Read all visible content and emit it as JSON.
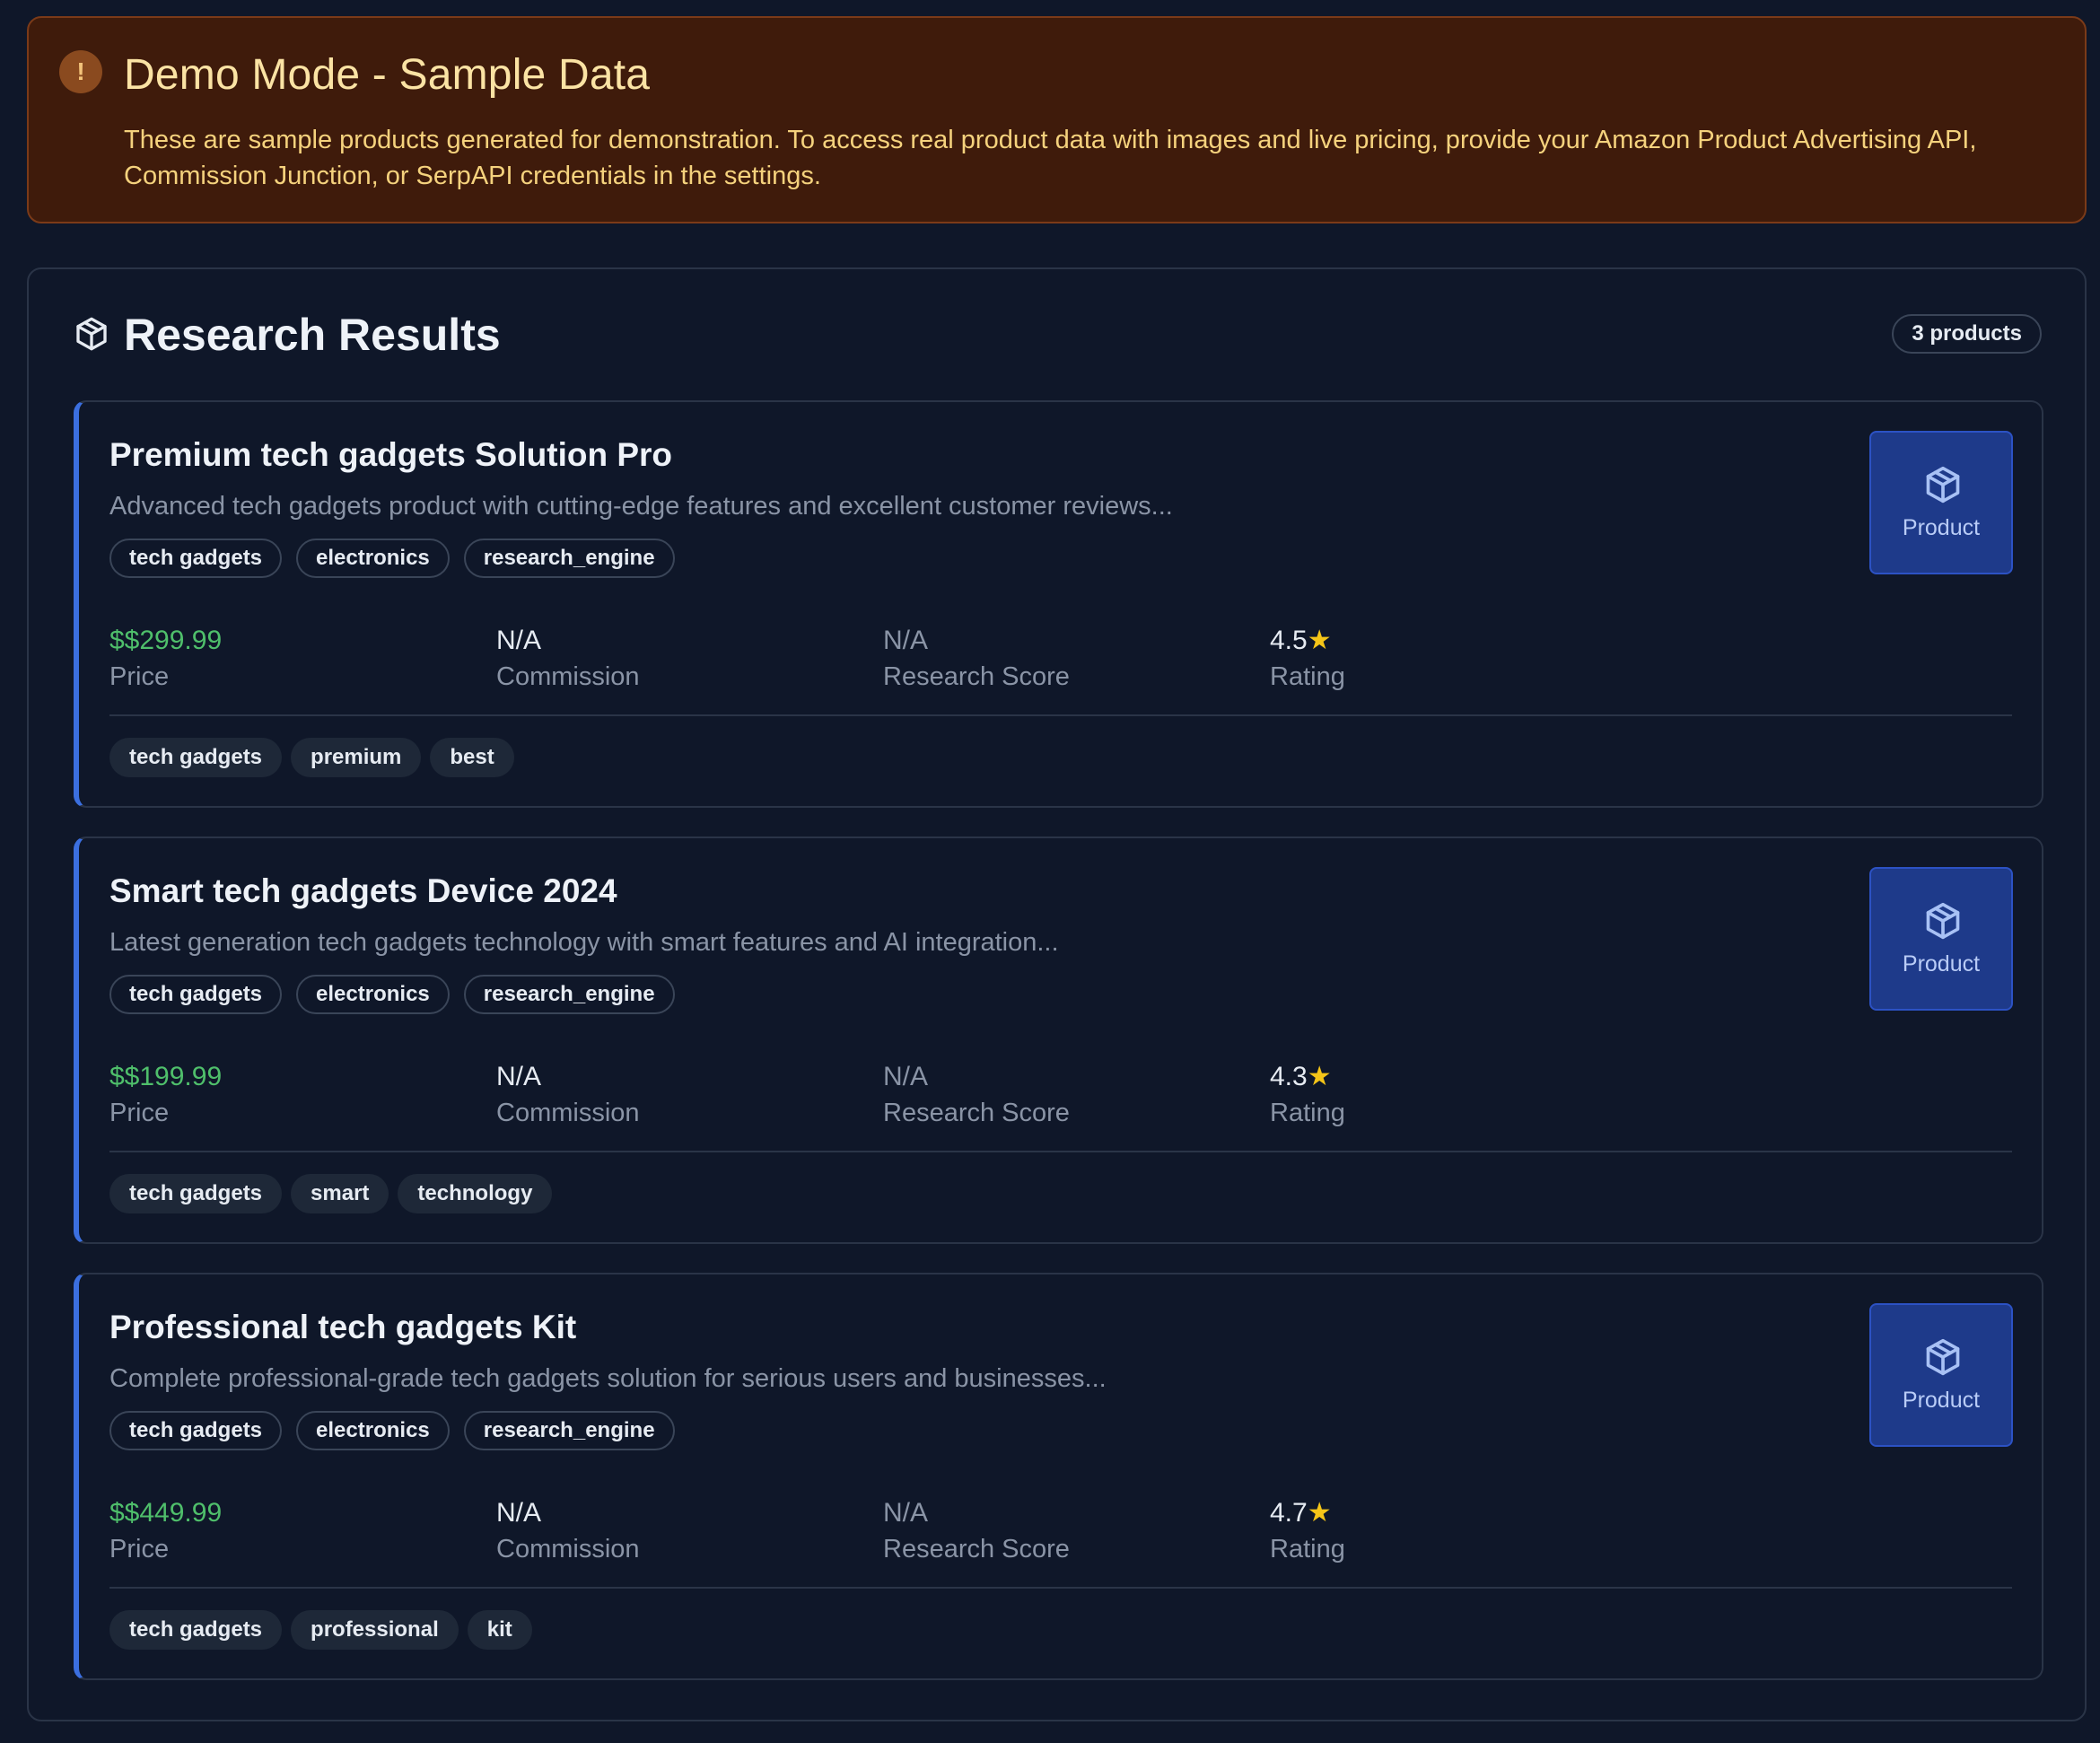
{
  "banner": {
    "icon": "exclamation-icon",
    "title": "Demo Mode - Sample Data",
    "text": "These are sample products generated for demonstration. To access real product data with images and live pricing, provide your Amazon Product Advertising API, Commission Junction, or SerpAPI credentials in the settings."
  },
  "results": {
    "icon": "package-icon",
    "title": "Research Results",
    "count": "3 products",
    "labels": {
      "price": "Price",
      "commission": "Commission",
      "score": "Research Score",
      "rating": "Rating",
      "product_button": "Product"
    },
    "products": [
      {
        "title": "Premium tech gadgets Solution Pro",
        "description": "Advanced tech gadgets product with cutting-edge features and excellent customer reviews...",
        "categories": [
          "tech gadgets",
          "electronics",
          "research_engine"
        ],
        "price": "$$299.99",
        "commission": "N/A",
        "score": "N/A",
        "rating": "4.5",
        "tags": [
          "tech gadgets",
          "premium",
          "best"
        ]
      },
      {
        "title": "Smart tech gadgets Device 2024",
        "description": "Latest generation tech gadgets technology with smart features and AI integration...",
        "categories": [
          "tech gadgets",
          "electronics",
          "research_engine"
        ],
        "price": "$$199.99",
        "commission": "N/A",
        "score": "N/A",
        "rating": "4.3",
        "tags": [
          "tech gadgets",
          "smart",
          "technology"
        ]
      },
      {
        "title": "Professional tech gadgets Kit",
        "description": "Complete professional-grade tech gadgets solution for serious users and businesses...",
        "categories": [
          "tech gadgets",
          "electronics",
          "research_engine"
        ],
        "price": "$$449.99",
        "commission": "N/A",
        "score": "N/A",
        "rating": "4.7",
        "tags": [
          "tech gadgets",
          "professional",
          "kit"
        ]
      }
    ]
  },
  "colors": {
    "background": "#0f1729",
    "banner_bg": "#3f1b0b",
    "banner_text": "#f5d27d",
    "accent_blue": "#3b6fe0",
    "price_green": "#4fbf6b",
    "star": "#f5c518"
  }
}
